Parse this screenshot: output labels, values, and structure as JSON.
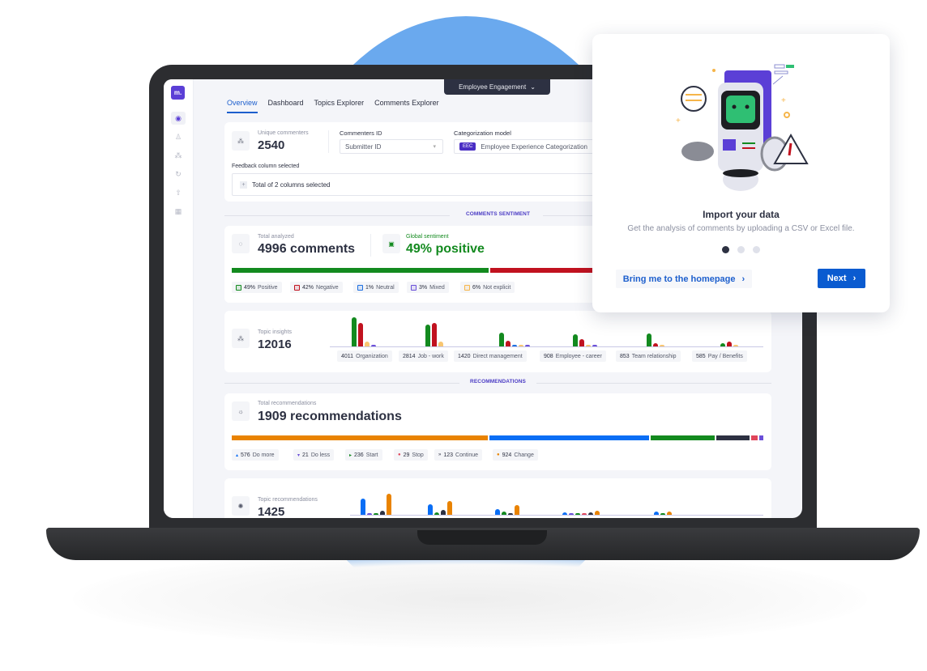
{
  "app": {
    "logo_text": "m.",
    "environment_selector": {
      "label": "Employee Engagement",
      "chevron": "chevron-down-icon"
    },
    "sidebar": {
      "items": [
        {
          "name": "dashboard",
          "icon": "speedometer-icon",
          "glyph": "◉",
          "active": true
        },
        {
          "name": "users",
          "icon": "user-icon",
          "glyph": "♙",
          "active": false
        },
        {
          "name": "topics",
          "icon": "hierarchy-icon",
          "glyph": "⁂",
          "active": false
        },
        {
          "name": "refresh",
          "icon": "refresh-icon",
          "glyph": "↻",
          "active": false
        },
        {
          "name": "upload",
          "icon": "upload-icon",
          "glyph": "⇧",
          "active": false
        },
        {
          "name": "apps",
          "icon": "grid-icon",
          "glyph": "▦",
          "active": false
        }
      ]
    },
    "tabs": [
      {
        "label": "Overview",
        "active": true
      },
      {
        "label": "Dashboard",
        "active": false
      },
      {
        "label": "Topics Explorer",
        "active": false
      },
      {
        "label": "Comments Explorer",
        "active": false
      }
    ]
  },
  "settings_card": {
    "unique_commenters_label": "Unique commenters",
    "unique_commenters_value": "2540",
    "commenters_id_label": "Commenters ID",
    "commenters_id_value": "Submitter ID",
    "categorization_model_label": "Categorization model",
    "categorization_model_badge": "EEC",
    "categorization_model_value": "Employee Experience Categorization",
    "feedback_column_label": "Feedback column selected",
    "feedback_column_value": "Total of 2 columns selected",
    "expand_glyph": "+"
  },
  "sentiment_section": {
    "title": "COMMENTS SENTIMENT",
    "total_label": "Total analyzed",
    "total_value": "4996 comments",
    "global_label": "Global sentiment",
    "global_value": "49% positive",
    "breakdown": [
      {
        "label": "Positive",
        "percent": 49,
        "text": "49%",
        "color": "#138a1f"
      },
      {
        "label": "Negative",
        "percent": 42,
        "text": "42%",
        "color": "#c1121f"
      },
      {
        "label": "Neutral",
        "percent": 1,
        "text": "1%",
        "color": "#1d6fe0"
      },
      {
        "label": "Mixed",
        "percent": 3,
        "text": "3%",
        "color": "#6a4fd8"
      },
      {
        "label": "Not explicit",
        "percent": 6,
        "text": "6%",
        "color": "#f6b54a"
      }
    ]
  },
  "topic_insights": {
    "label": "Topic insights",
    "value": "12016",
    "topics": [
      {
        "count": "4011",
        "name": "Organization",
        "bars": [
          100,
          80,
          18,
          5
        ]
      },
      {
        "count": "2814",
        "name": "Job - work",
        "bars": [
          74,
          80,
          18,
          0
        ]
      },
      {
        "count": "1420",
        "name": "Direct management",
        "bars": [
          46,
          20,
          5,
          5,
          5
        ]
      },
      {
        "count": "908",
        "name": "Employee - career",
        "bars": [
          42,
          24,
          5,
          5
        ]
      },
      {
        "count": "853",
        "name": "Team relationship",
        "bars": [
          44,
          10,
          5
        ]
      },
      {
        "count": "585",
        "name": "Pay / Benefits",
        "bars": [
          12,
          18,
          4
        ]
      }
    ],
    "bar_colors": [
      "#138a1f",
      "#c1121f",
      "#f8c671",
      "#6a4fd8"
    ],
    "bar_colors_5": [
      "#138a1f",
      "#c1121f",
      "#1d6fe0",
      "#f8c671",
      "#6a4fd8"
    ]
  },
  "recommendations_section": {
    "title": "RECOMMENDATIONS",
    "total_label": "Total recommendations",
    "total_value": "1909 recommendations",
    "bar": [
      {
        "type": "Change",
        "value": 924,
        "color": "#e98300"
      },
      {
        "type": "Do more",
        "value": 576,
        "color": "#0a6ef5"
      },
      {
        "type": "Start",
        "value": 236,
        "color": "#138a1f"
      },
      {
        "type": "Continue",
        "value": 123,
        "color": "#2d3142"
      },
      {
        "type": "Stop",
        "value": 29,
        "color": "#e0455a"
      },
      {
        "type": "Do less",
        "value": 21,
        "color": "#6a4fd8"
      }
    ],
    "chips": [
      {
        "count": "576",
        "label": "Do more",
        "glyph": "▴",
        "color": "#0a6ef5"
      },
      {
        "count": "21",
        "label": "Do less",
        "glyph": "▾",
        "color": "#6a4fd8"
      },
      {
        "count": "236",
        "label": "Start",
        "glyph": "▸",
        "color": "#138a1f"
      },
      {
        "count": "29",
        "label": "Stop",
        "glyph": "●",
        "color": "#e0455a"
      },
      {
        "count": "123",
        "label": "Continue",
        "glyph": "»",
        "color": "#2d3142"
      },
      {
        "count": "924",
        "label": "Change",
        "glyph": "●",
        "color": "#e98300"
      }
    ]
  },
  "topic_recommendations": {
    "label": "Topic recommendations",
    "value": "1425",
    "groups": [
      [
        {
          "v": 62,
          "c": "#0a6ef5"
        },
        {
          "v": 6,
          "c": "#6a4fd8"
        },
        {
          "v": 6,
          "c": "#138a1f"
        },
        {
          "v": 14,
          "c": "#2d3142"
        },
        {
          "v": 80,
          "c": "#e98300"
        }
      ],
      [
        {
          "v": 40,
          "c": "#0a6ef5"
        },
        {
          "v": 8,
          "c": "#138a1f"
        },
        {
          "v": 18,
          "c": "#2d3142"
        },
        {
          "v": 52,
          "c": "#e98300"
        }
      ],
      [
        {
          "v": 22,
          "c": "#0a6ef5"
        },
        {
          "v": 12,
          "c": "#138a1f"
        },
        {
          "v": 5,
          "c": "#2d3142"
        },
        {
          "v": 36,
          "c": "#e98300"
        }
      ],
      [
        {
          "v": 8,
          "c": "#0a6ef5"
        },
        {
          "v": 5,
          "c": "#6a4fd8"
        },
        {
          "v": 5,
          "c": "#138a1f"
        },
        {
          "v": 5,
          "c": "#e0455a"
        },
        {
          "v": 10,
          "c": "#2d3142"
        },
        {
          "v": 16,
          "c": "#e98300"
        }
      ],
      [
        {
          "v": 12,
          "c": "#0a6ef5"
        },
        {
          "v": 6,
          "c": "#138a1f"
        },
        {
          "v": 12,
          "c": "#e98300"
        }
      ]
    ]
  },
  "onboarding_popup": {
    "title": "Import your data",
    "description": "Get the analysis of comments by uploading a CSV or Excel file.",
    "step": 1,
    "total_steps": 3,
    "secondary_button": "Bring me to the homepage",
    "primary_button": "Next",
    "chevron": "›",
    "illustration": "robot-illustration"
  }
}
